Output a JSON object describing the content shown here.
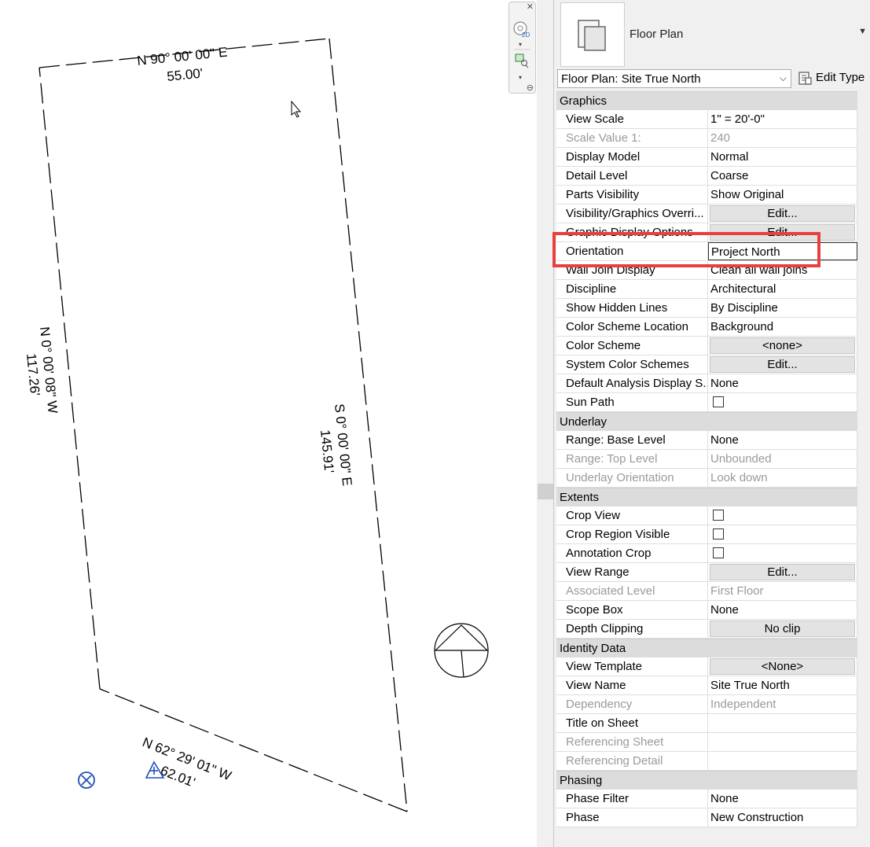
{
  "canvas": {
    "bearings": {
      "top": {
        "bearing": "N 90° 00' 00\" E",
        "distance": "55.00'"
      },
      "left": {
        "bearing": "N 0° 00' 08\" W",
        "distance": "117.26'"
      },
      "right": {
        "bearing": "S 0° 00' 00\" E",
        "distance": "145.91'"
      },
      "bottom": {
        "bearing": "N 62° 29' 01\" W",
        "distance": "62.01'"
      }
    }
  },
  "properties": {
    "type_name": "Floor Plan",
    "view_selector": "Floor Plan: Site True North",
    "edit_type_label": "Edit Type",
    "categories": [
      {
        "name": "Graphics",
        "rows": [
          {
            "key": "View Scale",
            "value": "1\" = 20'-0\"",
            "kind": "text"
          },
          {
            "key": "Scale Value    1:",
            "value": "240",
            "kind": "text",
            "readonly": true
          },
          {
            "key": "Display Model",
            "value": "Normal",
            "kind": "text"
          },
          {
            "key": "Detail Level",
            "value": "Coarse",
            "kind": "text"
          },
          {
            "key": "Parts Visibility",
            "value": "Show Original",
            "kind": "text"
          },
          {
            "key": "Visibility/Graphics Overri...",
            "value": "Edit...",
            "kind": "button"
          },
          {
            "key": "Graphic Display Options",
            "value": "Edit...",
            "kind": "button"
          },
          {
            "key": "Orientation",
            "value": "Project North",
            "kind": "editing"
          },
          {
            "key": "Wall Join Display",
            "value": "Clean all wall joins",
            "kind": "text"
          },
          {
            "key": "Discipline",
            "value": "Architectural",
            "kind": "text"
          },
          {
            "key": "Show Hidden Lines",
            "value": "By Discipline",
            "kind": "text"
          },
          {
            "key": "Color Scheme Location",
            "value": "Background",
            "kind": "text"
          },
          {
            "key": "Color Scheme",
            "value": "<none>",
            "kind": "button"
          },
          {
            "key": "System Color Schemes",
            "value": "Edit...",
            "kind": "button"
          },
          {
            "key": "Default Analysis Display S...",
            "value": "None",
            "kind": "text"
          },
          {
            "key": "Sun Path",
            "value": "",
            "kind": "checkbox"
          }
        ]
      },
      {
        "name": "Underlay",
        "rows": [
          {
            "key": "Range: Base Level",
            "value": "None",
            "kind": "text"
          },
          {
            "key": "Range: Top Level",
            "value": "Unbounded",
            "kind": "text",
            "readonly": true
          },
          {
            "key": "Underlay Orientation",
            "value": "Look down",
            "kind": "text",
            "readonly": true
          }
        ]
      },
      {
        "name": "Extents",
        "rows": [
          {
            "key": "Crop View",
            "value": "",
            "kind": "checkbox"
          },
          {
            "key": "Crop Region Visible",
            "value": "",
            "kind": "checkbox"
          },
          {
            "key": "Annotation Crop",
            "value": "",
            "kind": "checkbox"
          },
          {
            "key": "View Range",
            "value": "Edit...",
            "kind": "button"
          },
          {
            "key": "Associated Level",
            "value": "First Floor",
            "kind": "text",
            "readonly": true
          },
          {
            "key": "Scope Box",
            "value": "None",
            "kind": "text"
          },
          {
            "key": "Depth Clipping",
            "value": "No clip",
            "kind": "button"
          }
        ]
      },
      {
        "name": "Identity Data",
        "rows": [
          {
            "key": "View Template",
            "value": "<None>",
            "kind": "button"
          },
          {
            "key": "View Name",
            "value": "Site True North",
            "kind": "text"
          },
          {
            "key": "Dependency",
            "value": "Independent",
            "kind": "text",
            "readonly": true
          },
          {
            "key": "Title on Sheet",
            "value": "",
            "kind": "text"
          },
          {
            "key": "Referencing Sheet",
            "value": "",
            "kind": "text",
            "readonly": true
          },
          {
            "key": "Referencing Detail",
            "value": "",
            "kind": "text",
            "readonly": true
          }
        ]
      },
      {
        "name": "Phasing",
        "rows": [
          {
            "key": "Phase Filter",
            "value": "None",
            "kind": "text"
          },
          {
            "key": "Phase",
            "value": "New Construction",
            "kind": "text"
          }
        ]
      }
    ]
  },
  "colors": {
    "highlight": "#e8403f",
    "survey_point": "#1f4fb5",
    "category_bg": "#dcdcdc"
  },
  "icons": [
    "view-cube-2d-icon",
    "zoom-region-icon",
    "floor-plan-type-icon",
    "edit-type-icon",
    "survey-point-icon",
    "project-base-point-icon",
    "north-arrow-icon",
    "cursor-icon"
  ]
}
